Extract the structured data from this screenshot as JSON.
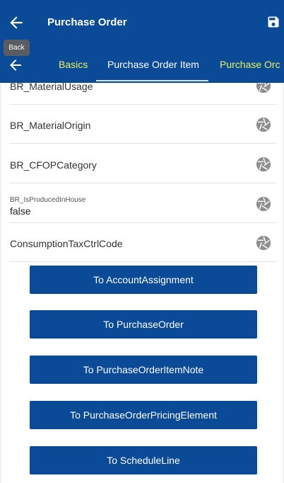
{
  "header": {
    "title": "Purchase Order",
    "back_icon": "back-arrow-icon",
    "save_icon": "save-icon"
  },
  "tooltip": "Back",
  "tabs": [
    {
      "label": "Basics"
    },
    {
      "label": "Purchase Order Item"
    },
    {
      "label": "Purchase Orc"
    }
  ],
  "rows": [
    {
      "label": "BR_MaterialUsage"
    },
    {
      "label": "BR_MaterialOrigin"
    },
    {
      "label": "BR_CFOPCategory"
    },
    {
      "label": "BR_IsProducedInHouse",
      "value": "false"
    },
    {
      "label": "ConsumptionTaxCtrlCode"
    }
  ],
  "buttons": [
    {
      "label": "To AccountAssignment"
    },
    {
      "label": "To PurchaseOrder"
    },
    {
      "label": "To PurchaseOrderItemNote"
    },
    {
      "label": "To PurchaseOrderPricingElement"
    },
    {
      "label": "To ScheduleLine"
    }
  ],
  "colors": {
    "brand": "#0a4a96",
    "active_tab": "#ffffff",
    "inactive_tab": "#e8f25a"
  }
}
